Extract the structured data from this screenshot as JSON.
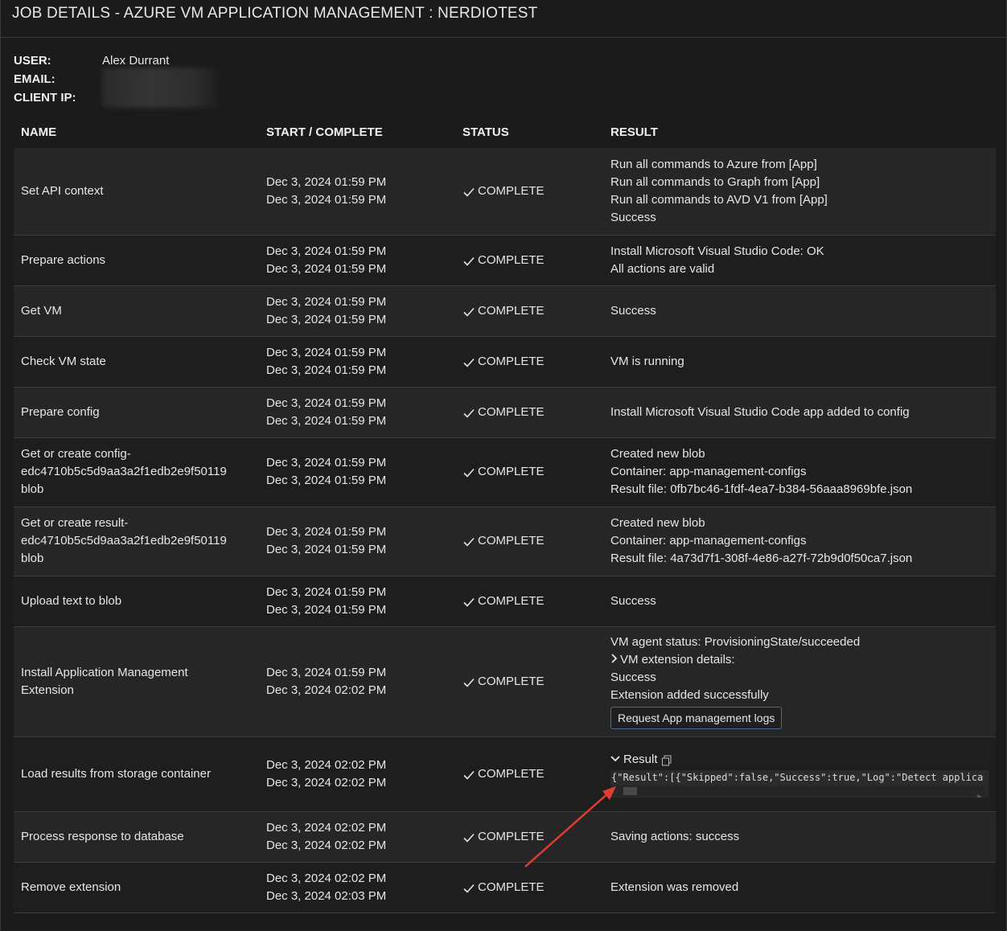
{
  "header": {
    "title": "JOB DETAILS - AZURE VM APPLICATION MANAGEMENT : NERDIOTEST"
  },
  "user_info": {
    "user_label": "USER:",
    "user_value": "Alex Durrant",
    "email_label": "EMAIL:",
    "client_ip_label": "CLIENT IP:"
  },
  "table": {
    "columns": [
      "NAME",
      "START / COMPLETE",
      "STATUS",
      "RESULT"
    ],
    "rows": [
      {
        "name": [
          "Set API context"
        ],
        "start": "Dec 3, 2024 01:59 PM",
        "complete": "Dec 3, 2024 01:59 PM",
        "status": "COMPLETE",
        "result": [
          "Run all commands to Azure from [App]",
          "Run all commands to Graph from [App]",
          "Run all commands to AVD V1 from [App]",
          "Success"
        ]
      },
      {
        "name": [
          "Prepare actions"
        ],
        "start": "Dec 3, 2024 01:59 PM",
        "complete": "Dec 3, 2024 01:59 PM",
        "status": "COMPLETE",
        "result": [
          "Install Microsoft Visual Studio Code: OK",
          "All actions are valid"
        ]
      },
      {
        "name": [
          "Get VM"
        ],
        "start": "Dec 3, 2024 01:59 PM",
        "complete": "Dec 3, 2024 01:59 PM",
        "status": "COMPLETE",
        "result": [
          "Success"
        ]
      },
      {
        "name": [
          "Check VM state"
        ],
        "start": "Dec 3, 2024 01:59 PM",
        "complete": "Dec 3, 2024 01:59 PM",
        "status": "COMPLETE",
        "result": [
          "VM is running"
        ]
      },
      {
        "name": [
          "Prepare config"
        ],
        "start": "Dec 3, 2024 01:59 PM",
        "complete": "Dec 3, 2024 01:59 PM",
        "status": "COMPLETE",
        "result": [
          "Install Microsoft Visual Studio Code app added to config"
        ]
      },
      {
        "name": [
          "Get or create config-",
          "edc4710b5c5d9aa3a2f1edb2e9f50119",
          "blob"
        ],
        "start": "Dec 3, 2024 01:59 PM",
        "complete": "Dec 3, 2024 01:59 PM",
        "status": "COMPLETE",
        "result": [
          "Created new blob",
          "Container: app-management-configs",
          "Result file: 0fb7bc46-1fdf-4ea7-b384-56aaa8969bfe.json"
        ]
      },
      {
        "name": [
          "Get or create result-",
          "edc4710b5c5d9aa3a2f1edb2e9f50119",
          "blob"
        ],
        "start": "Dec 3, 2024 01:59 PM",
        "complete": "Dec 3, 2024 01:59 PM",
        "status": "COMPLETE",
        "result": [
          "Created new blob",
          "Container: app-management-configs",
          "Result file: 4a73d7f1-308f-4e86-a27f-72b9d0f50ca7.json"
        ]
      },
      {
        "name": [
          "Upload text to blob"
        ],
        "start": "Dec 3, 2024 01:59 PM",
        "complete": "Dec 3, 2024 01:59 PM",
        "status": "COMPLETE",
        "result": [
          "Success"
        ]
      },
      {
        "name": [
          "Install Application Management",
          "Extension"
        ],
        "start": "Dec 3, 2024 01:59 PM",
        "complete": "Dec 3, 2024 02:02 PM",
        "status": "COMPLETE",
        "result": [
          "VM agent status: ProvisioningState/succeeded",
          "VM extension details:",
          "Success",
          "Extension added successfully"
        ],
        "button": "Request App management logs"
      },
      {
        "name": [
          "Load results from storage container"
        ],
        "start": "Dec 3, 2024 02:02 PM",
        "complete": "Dec 3, 2024 02:02 PM",
        "status": "COMPLETE",
        "result_toggle": "Result",
        "result_code": "{\"Result\":[{\"Skipped\":false,\"Success\":true,\"Log\":\"Detect applica"
      },
      {
        "name": [
          "Process response to database"
        ],
        "start": "Dec 3, 2024 02:02 PM",
        "complete": "Dec 3, 2024 02:02 PM",
        "status": "COMPLETE",
        "result": [
          "Saving actions: success"
        ]
      },
      {
        "name": [
          "Remove extension"
        ],
        "start": "Dec 3, 2024 02:02 PM",
        "complete": "Dec 3, 2024 02:03 PM",
        "status": "COMPLETE",
        "result": [
          "Extension was removed"
        ]
      }
    ]
  },
  "icons": {
    "status_icon": "check-icon",
    "expander_collapsed": "chevron-right-icon",
    "expander_expanded": "chevron-down-icon",
    "copy": "copy-icon"
  },
  "colors": {
    "annotation_arrow": "#e03c31",
    "button_border": "#4a6a90"
  }
}
